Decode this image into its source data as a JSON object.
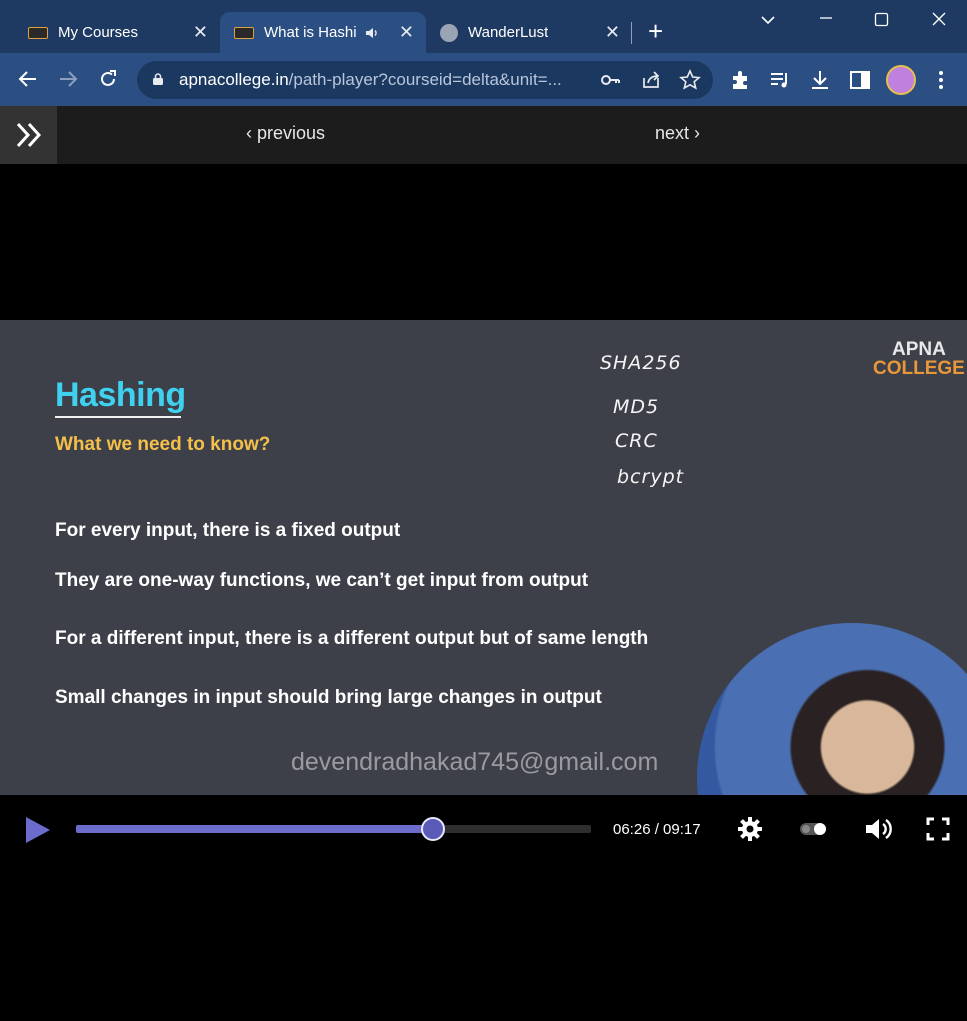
{
  "browser": {
    "tabs": [
      {
        "title": "My Courses",
        "favicon": "apna-college-icon"
      },
      {
        "title": "What is Hashi",
        "favicon": "apna-college-icon",
        "audio": true
      },
      {
        "title": "WanderLust",
        "favicon": "globe-icon"
      }
    ],
    "close_glyph": "✕",
    "new_tab_glyph": "+",
    "url_host": "apnacollege.in",
    "url_path": "/path-player?courseid=delta&unit=..."
  },
  "player_nav": {
    "previous": "‹ previous",
    "next": "next ›"
  },
  "slide": {
    "title": "Hashing",
    "subtitle": "What we need to know?",
    "points": [
      "For every input, there is a fixed output",
      "They are one-way functions, we can’t get input from output",
      "For a different input, there is a different output but of same length",
      "Small changes in input should bring large changes in output"
    ],
    "handwritten": [
      "SHA256",
      "MD5",
      "CRC",
      "bcrypt"
    ],
    "brand_line1": "APNA",
    "brand_line2": "COLLEGE",
    "watermark": "devendradhakad745@gmail.com"
  },
  "player": {
    "time": "06:26 / 09:17",
    "progress": 0.694
  },
  "colors": {
    "tab_strip": "#1e3a63",
    "toolbar": "#2b4f82",
    "slide_bg": "#3d4048",
    "title": "#3fd2f0",
    "subtitle": "#f4c04a",
    "brand_orange": "#e8973a",
    "progress": "#6b6ccc"
  }
}
